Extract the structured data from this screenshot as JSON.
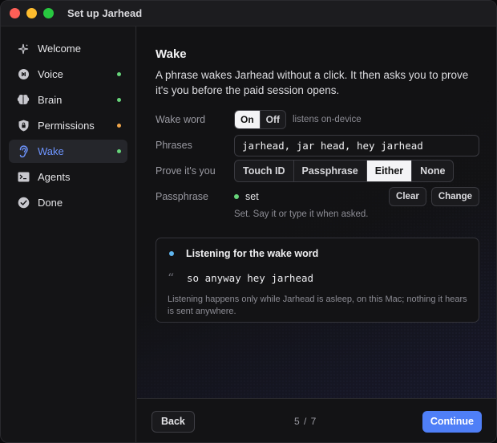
{
  "window": {
    "title": "Set up Jarhead"
  },
  "sidebar": {
    "items": [
      {
        "label": "Welcome",
        "icon": "sparkle-icon",
        "status": null
      },
      {
        "label": "Voice",
        "icon": "voice-icon",
        "status": "#67d47a"
      },
      {
        "label": "Brain",
        "icon": "brain-icon",
        "status": "#67d47a"
      },
      {
        "label": "Permissions",
        "icon": "shield-icon",
        "status": "#f0a64a"
      },
      {
        "label": "Wake",
        "icon": "ear-icon",
        "status": "#67d47a",
        "active": true
      },
      {
        "label": "Agents",
        "icon": "terminal-icon",
        "status": null
      },
      {
        "label": "Done",
        "icon": "check-circle-icon",
        "status": null
      }
    ]
  },
  "main": {
    "title": "Wake",
    "intro": "A phrase wakes Jarhead without a click. It then asks you to prove it's you before the paid session opens.",
    "wake_word": {
      "label": "Wake word",
      "options": [
        "On",
        "Off"
      ],
      "selected": "On",
      "hint": "listens on-device"
    },
    "phrases": {
      "label": "Phrases",
      "value": "jarhead, jar head, hey jarhead"
    },
    "prove": {
      "label": "Prove it's you",
      "options": [
        "Touch ID",
        "Passphrase",
        "Either",
        "None"
      ],
      "selected": "Either"
    },
    "passphrase": {
      "label": "Passphrase",
      "status": "set",
      "status_color": "#67d47a",
      "clear": "Clear",
      "change": "Change",
      "hint": "Set. Say it or type it when asked."
    },
    "listening": {
      "title": "Listening for the wake word",
      "dot_color": "#5fb6f0",
      "quote_mark": "“",
      "heard": "so anyway hey jarhead",
      "note": "Listening happens only while Jarhead is asleep, on this Mac; nothing it hears is sent anywhere."
    }
  },
  "footer": {
    "back": "Back",
    "pager": "5 / 7",
    "continue": "Continue"
  },
  "colors": {
    "accent": "#4f7ff7",
    "active_nav_text": "#6e95ff"
  }
}
